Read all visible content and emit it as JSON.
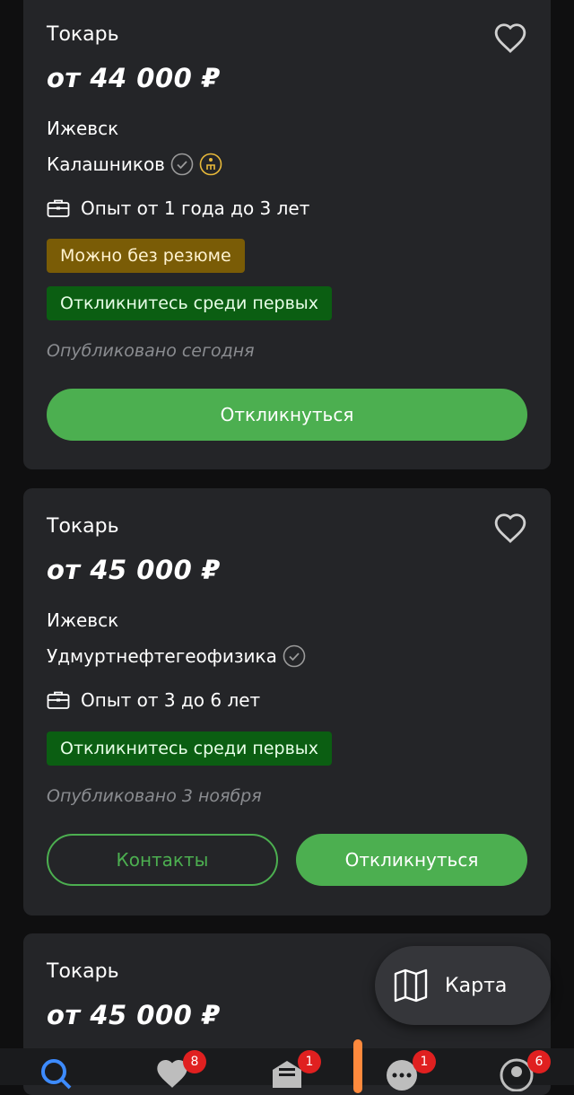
{
  "cards": [
    {
      "title": "Токарь",
      "salary": "от 44 000 ₽",
      "city": "Ижевск",
      "company": "Калашников",
      "experience": "Опыт от 1 года до 3 лет",
      "badge_no_resume": "Можно без резюме",
      "badge_first": "Откликнитесь среди первых",
      "published": "Опубликовано сегодня",
      "respond_label": "Откликнуться"
    },
    {
      "title": "Токарь",
      "salary": "от 45 000 ₽",
      "city": "Ижевск",
      "company": "Удмуртнефтегеофизика",
      "experience": "Опыт от 3 до 6 лет",
      "badge_first": "Откликнитесь среди первых",
      "published": "Опубликовано 3 ноября",
      "contacts_label": "Контакты",
      "respond_label": "Откликнуться"
    },
    {
      "title": "Токарь",
      "salary": "от 45 000 ₽"
    }
  ],
  "map_button": {
    "label": "Карта"
  },
  "bottom_nav": {
    "favorites_badge": "8",
    "responses_badge": "1",
    "messages_badge": "1",
    "profile_badge": "6"
  },
  "colors": {
    "accent_green": "#4caf50",
    "badge_yellow": "#7a5c06",
    "badge_green": "#0b5e12",
    "card_bg": "#242528"
  }
}
